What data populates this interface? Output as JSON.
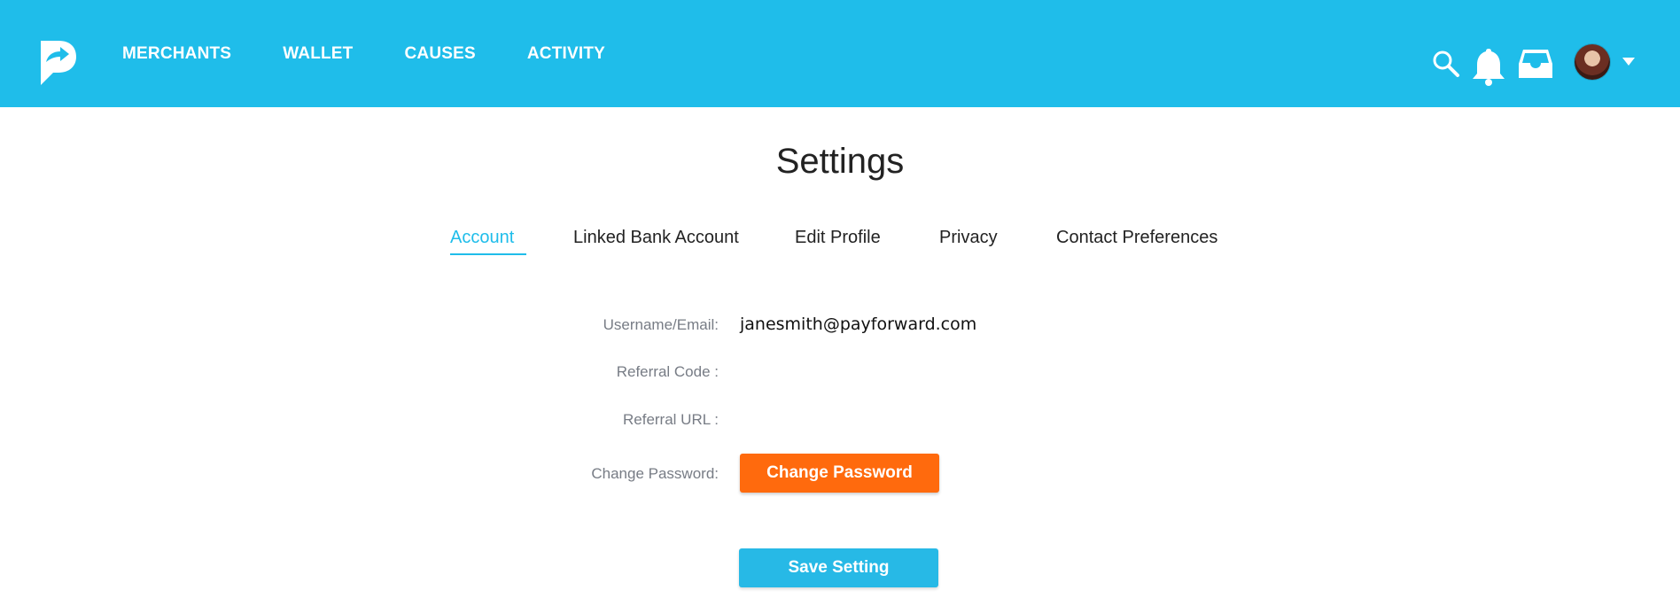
{
  "header": {
    "brand_color": "#1fbdea",
    "nav": [
      {
        "label": "MERCHANTS"
      },
      {
        "label": "WALLET"
      },
      {
        "label": "CAUSES"
      },
      {
        "label": "ACTIVITY"
      }
    ],
    "icons": [
      "search-icon",
      "bell-icon",
      "inbox-icon",
      "avatar",
      "chevron-down-icon"
    ]
  },
  "page": {
    "title": "Settings",
    "tabs": [
      {
        "label": "Account",
        "active": true
      },
      {
        "label": "Linked Bank Account"
      },
      {
        "label": "Edit Profile"
      },
      {
        "label": "Privacy"
      },
      {
        "label": "Contact Preferences"
      }
    ],
    "account": {
      "username_label": "Username/Email:",
      "username_value": "janesmith@payforward.com",
      "referral_code_label": "Referral Code :",
      "referral_code_value": "",
      "referral_url_label": "Referral URL :",
      "referral_url_value": "",
      "change_password_label": "Change Password:",
      "change_password_button": "Change Password"
    },
    "save_button": "Save Setting"
  },
  "colors": {
    "accent": "#1fbdea",
    "orange_button": "#ff6a0d",
    "label_gray": "#777c85"
  }
}
